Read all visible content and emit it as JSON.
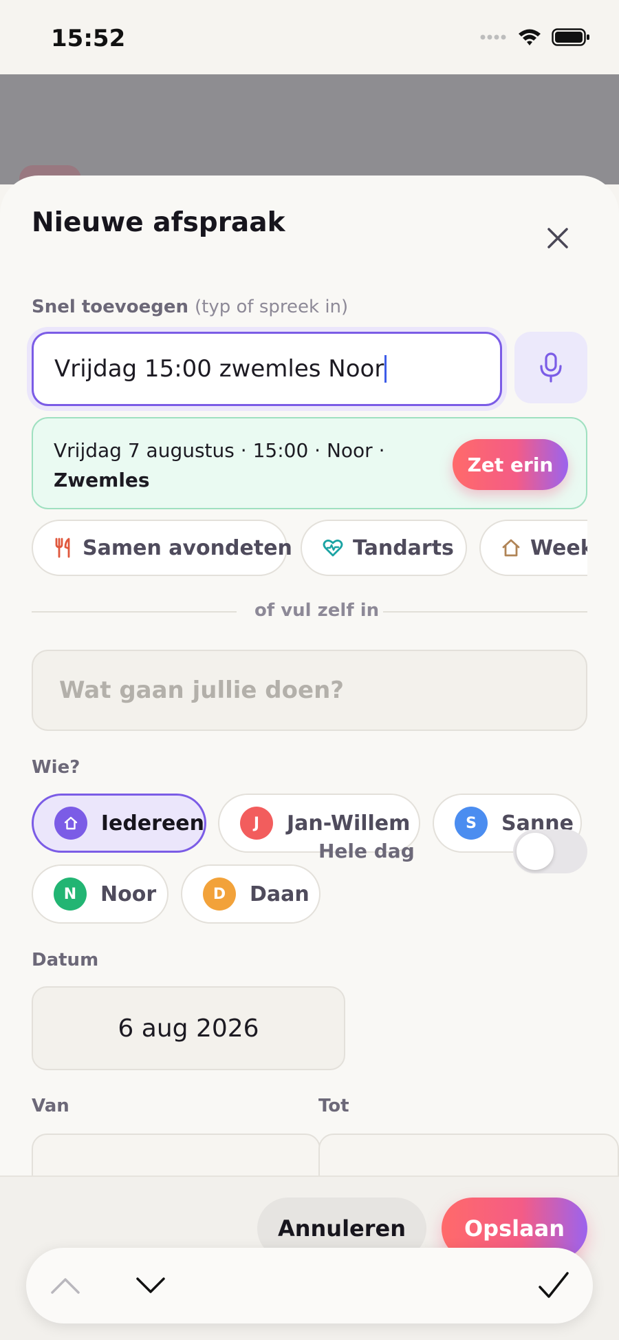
{
  "status": {
    "time": "15:52"
  },
  "sheet": {
    "title": "Nieuwe afspraak"
  },
  "quick_add": {
    "label": "Snel toevoegen",
    "hint": "(typ of spreek in)",
    "value": "Vrijdag 15:00 zwemles Noor"
  },
  "suggestion": {
    "line1": "Vrijdag 7 augustus · 15:00 · Noor ·",
    "line2": "Zwemles",
    "button": "Zet erin"
  },
  "templates": [
    {
      "label": "Samen avondeten",
      "icon": "utensils-icon",
      "color": "#e0573c"
    },
    {
      "label": "Tandarts",
      "icon": "heart-pulse-icon",
      "color": "#1aa3a3"
    },
    {
      "label": "Weekend",
      "icon": "home-icon",
      "color": "#b08456"
    }
  ],
  "divider_text": "of vul zelf in",
  "what": {
    "placeholder": "Wat gaan jullie doen?"
  },
  "who": {
    "label": "Wie?",
    "people": [
      {
        "name": "Iedereen",
        "initial": "",
        "color": "#7b5ce6",
        "selected": true
      },
      {
        "name": "Jan-Willem",
        "initial": "J",
        "color": "#f25d5d",
        "selected": false
      },
      {
        "name": "Sanne",
        "initial": "S",
        "color": "#4b8df0",
        "selected": false
      },
      {
        "name": "Noor",
        "initial": "N",
        "color": "#22b573",
        "selected": false
      },
      {
        "name": "Daan",
        "initial": "D",
        "color": "#f2a23a",
        "selected": false
      }
    ]
  },
  "date": {
    "label": "Datum",
    "value": "6 aug 2026",
    "all_day_label": "Hele dag",
    "all_day": false
  },
  "time": {
    "from_label": "Van",
    "to_label": "Tot"
  },
  "footer": {
    "cancel": "Annuleren",
    "save": "Opslaan"
  },
  "colors": {
    "accent": "#7b5ce6",
    "gradient_start": "#ff6a6a",
    "gradient_end": "#9b63ee"
  }
}
